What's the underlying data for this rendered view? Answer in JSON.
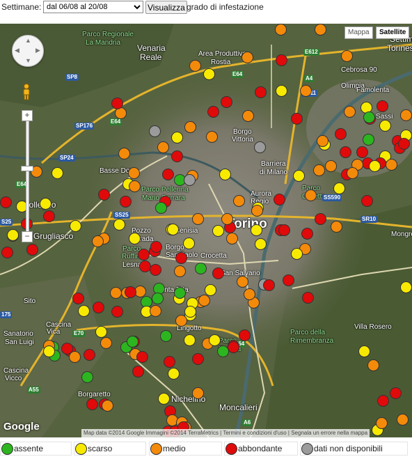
{
  "toolbar": {
    "weeks_label": "Settimane:",
    "weeks_selected": "dal 06/08 al 20/08",
    "show_button": "Visualizza",
    "legend_title": "grado di infestazione"
  },
  "map": {
    "type_buttons": [
      "Mappa",
      "Satellite"
    ],
    "active_type": "Satellite",
    "attribution": "Map data ©2014 Google Immagini ©2014 TerraMetrics | Termini e condizioni d'uso | Segnala un errore nella mappa",
    "google_logo": "Google",
    "zoom_in_label": "+",
    "zoom_out_label": "−",
    "icons": [
      "pan-control-icon",
      "pegman-icon",
      "zoom-in-icon",
      "zoom-out-icon"
    ],
    "place_labels": [
      {
        "text": "Venaria",
        "cls": "med"
      },
      {
        "text": "Reale",
        "cls": "med"
      },
      {
        "text": "Parco Regionale",
        "cls": "green"
      },
      {
        "text": "La Mandria",
        "cls": "green"
      },
      {
        "text": "Area Produttiva",
        "cls": ""
      },
      {
        "text": "Rostia",
        "cls": ""
      },
      {
        "text": "Settimo",
        "cls": "med"
      },
      {
        "text": "Torinese",
        "cls": "med"
      },
      {
        "text": "Cebrosa 90",
        "cls": ""
      },
      {
        "text": "Olimpia",
        "cls": ""
      },
      {
        "text": "Famolenta",
        "cls": ""
      },
      {
        "text": "Sassi",
        "cls": ""
      },
      {
        "text": "Borgo",
        "cls": ""
      },
      {
        "text": "Vittoria",
        "cls": ""
      },
      {
        "text": "Barriera",
        "cls": ""
      },
      {
        "text": "di Milano",
        "cls": ""
      },
      {
        "text": "Basse Dora",
        "cls": ""
      },
      {
        "text": "Parco Pellerina",
        "cls": "green"
      },
      {
        "text": "Mario Carrara",
        "cls": "green"
      },
      {
        "text": "Aurora",
        "cls": ""
      },
      {
        "text": "Regio",
        "cls": ""
      },
      {
        "text": "Parco",
        "cls": "green"
      },
      {
        "text": "Colletta",
        "cls": "green"
      },
      {
        "text": "Collegno",
        "cls": "med"
      },
      {
        "text": "Grugliasco",
        "cls": "med"
      },
      {
        "text": "Pozzo",
        "cls": ""
      },
      {
        "text": "Strada",
        "cls": ""
      },
      {
        "text": "Cenisia",
        "cls": ""
      },
      {
        "text": "Torino",
        "cls": "big"
      },
      {
        "text": "Mongreno",
        "cls": ""
      },
      {
        "text": "Parco",
        "cls": "green"
      },
      {
        "text": "Ruffini",
        "cls": "green"
      },
      {
        "text": "Borgo",
        "cls": ""
      },
      {
        "text": "San Paolo",
        "cls": ""
      },
      {
        "text": "Crocetta",
        "cls": ""
      },
      {
        "text": "Lesna",
        "cls": ""
      },
      {
        "text": "San Salvario",
        "cls": ""
      },
      {
        "text": "Santa Rita",
        "cls": ""
      },
      {
        "text": "Sito",
        "cls": ""
      },
      {
        "text": "Lingotto",
        "cls": ""
      },
      {
        "text": "Villa Rosero",
        "cls": ""
      },
      {
        "text": "Cascina",
        "cls": ""
      },
      {
        "text": "Vica",
        "cls": ""
      },
      {
        "text": "Parco",
        "cls": "green"
      },
      {
        "text": "Europa",
        "cls": "green"
      },
      {
        "text": "Parco della",
        "cls": "green"
      },
      {
        "text": "Rimembranza",
        "cls": "green"
      },
      {
        "text": "Sanatorio",
        "cls": ""
      },
      {
        "text": "San Luigi",
        "cls": ""
      },
      {
        "text": "Cascina",
        "cls": ""
      },
      {
        "text": "Vicco",
        "cls": ""
      },
      {
        "text": "Borgaretto",
        "cls": ""
      },
      {
        "text": "Nichelino",
        "cls": "med"
      },
      {
        "text": "Moncalieri",
        "cls": "med"
      }
    ],
    "road_shields": [
      {
        "text": "SP8",
        "cls": ""
      },
      {
        "text": "E64",
        "cls": "green"
      },
      {
        "text": "SP176",
        "cls": ""
      },
      {
        "text": "SP24",
        "cls": ""
      },
      {
        "text": "E64",
        "cls": "green"
      },
      {
        "text": "E612",
        "cls": "green"
      },
      {
        "text": "A4",
        "cls": "green"
      },
      {
        "text": "E64",
        "cls": "green"
      },
      {
        "text": "SS11",
        "cls": ""
      },
      {
        "text": "S25",
        "cls": ""
      },
      {
        "text": "SS25",
        "cls": ""
      },
      {
        "text": "SS590",
        "cls": ""
      },
      {
        "text": "SR10",
        "cls": ""
      },
      {
        "text": "E70",
        "cls": "green"
      },
      {
        "text": "A55",
        "cls": "green"
      },
      {
        "text": "A6",
        "cls": "green"
      },
      {
        "text": "E64",
        "cls": "green"
      },
      {
        "text": "175",
        "cls": ""
      }
    ]
  },
  "legend": {
    "items": [
      {
        "label": "assente",
        "color": "#2db51f"
      },
      {
        "label": "scarso",
        "color": "#f7ea00"
      },
      {
        "label": "medio",
        "color": "#f48a0a"
      },
      {
        "label": "abbondante",
        "color": "#e00a0a"
      },
      {
        "label": "dati non disponibili",
        "color": "#9b9b9b"
      }
    ]
  },
  "markers": [
    {
      "level": "medio"
    },
    {
      "level": "medio"
    },
    {
      "level": "medio"
    },
    {
      "level": "abbondante"
    },
    {
      "level": "medio"
    },
    {
      "level": "scarso"
    },
    {
      "level": "medio"
    },
    {
      "level": "abbondante"
    },
    {
      "level": "medio"
    },
    {
      "level": "scarso"
    },
    {
      "level": "abbondante"
    },
    {
      "level": "scarso"
    },
    {
      "level": "medio"
    },
    {
      "level": "abbondante"
    },
    {
      "level": "medio"
    },
    {
      "level": "abbondante"
    },
    {
      "level": "abbondante"
    },
    {
      "level": "abbondante"
    },
    {
      "level": "medio"
    },
    {
      "level": "medio"
    },
    {
      "level": "abbondante"
    },
    {
      "level": "abbondante"
    },
    {
      "level": "scarso"
    },
    {
      "level": "assente"
    },
    {
      "level": "scarso"
    },
    {
      "level": "abbondante"
    },
    {
      "level": "abbondante"
    },
    {
      "level": "scarso"
    },
    {
      "level": "abbondante"
    },
    {
      "level": "medio"
    },
    {
      "level": "abbondante"
    },
    {
      "level": "scarso"
    },
    {
      "level": "abbondante"
    },
    {
      "level": "dati non disponibili"
    },
    {
      "level": "medio"
    },
    {
      "level": "medio"
    },
    {
      "level": "medio"
    },
    {
      "level": "dati non disponibili"
    },
    {
      "level": "scarso"
    },
    {
      "level": "medio"
    },
    {
      "level": "abbondante"
    },
    {
      "level": "abbondante"
    },
    {
      "level": "abbondante"
    },
    {
      "level": "medio"
    },
    {
      "level": "scarso"
    },
    {
      "level": "medio"
    },
    {
      "level": "scarso"
    },
    {
      "level": "abbondante"
    },
    {
      "level": "assente"
    },
    {
      "level": "scarso"
    },
    {
      "level": "medio"
    },
    {
      "level": "medio"
    },
    {
      "level": "abbondante"
    },
    {
      "level": "medio"
    },
    {
      "level": "abbondante"
    },
    {
      "level": "medio"
    },
    {
      "level": "scarso"
    },
    {
      "level": "abbondante"
    },
    {
      "level": "medio"
    },
    {
      "level": "scarso"
    },
    {
      "level": "assente"
    },
    {
      "level": "abbondante"
    },
    {
      "level": "dati non disponibili"
    },
    {
      "level": "scarso"
    },
    {
      "level": "scarso"
    },
    {
      "level": "medio"
    },
    {
      "level": "abbondante"
    },
    {
      "level": "scarso"
    },
    {
      "level": "medio"
    },
    {
      "level": "abbondante"
    },
    {
      "level": "abbondante"
    },
    {
      "level": "medio"
    },
    {
      "level": "abbondante"
    },
    {
      "level": "medio"
    },
    {
      "level": "scarso"
    },
    {
      "level": "medio"
    },
    {
      "level": "abbondante"
    },
    {
      "level": "scarso"
    },
    {
      "level": "abbondante"
    },
    {
      "level": "scarso"
    },
    {
      "level": "abbondante"
    },
    {
      "level": "scarso"
    },
    {
      "level": "medio"
    },
    {
      "level": "abbondante"
    },
    {
      "level": "medio"
    },
    {
      "level": "scarso"
    },
    {
      "level": "abbondante"
    },
    {
      "level": "scarso"
    },
    {
      "level": "assente"
    },
    {
      "level": "scarso"
    },
    {
      "level": "abbondante"
    },
    {
      "level": "abbondante"
    },
    {
      "level": "medio"
    },
    {
      "level": "medio"
    },
    {
      "level": "scarso"
    },
    {
      "level": "scarso"
    },
    {
      "level": "medio"
    },
    {
      "level": "abbondante"
    },
    {
      "level": "medio"
    },
    {
      "level": "abbondante"
    },
    {
      "level": "scarso"
    },
    {
      "level": "scarso"
    },
    {
      "level": "scarso"
    },
    {
      "level": "abbondante"
    },
    {
      "level": "abbondante"
    },
    {
      "level": "abbondante"
    },
    {
      "level": "medio"
    },
    {
      "level": "scarso"
    },
    {
      "level": "abbondante"
    },
    {
      "level": "scarso"
    },
    {
      "level": "scarso"
    },
    {
      "level": "dati non disponibili"
    },
    {
      "level": "abbondante"
    },
    {
      "level": "assente"
    },
    {
      "level": "abbondante"
    },
    {
      "level": "medio"
    },
    {
      "level": "medio"
    },
    {
      "level": "medio"
    },
    {
      "level": "assente"
    },
    {
      "level": "abbondante"
    },
    {
      "level": "scarso"
    },
    {
      "level": "medio"
    },
    {
      "level": "medio"
    },
    {
      "level": "abbondante"
    },
    {
      "level": "medio"
    },
    {
      "level": "medio"
    },
    {
      "level": "scarso"
    },
    {
      "level": "abbondante"
    },
    {
      "level": "assente"
    },
    {
      "level": "scarso"
    },
    {
      "level": "medio"
    },
    {
      "level": "medio"
    },
    {
      "level": "abbondante"
    },
    {
      "level": "abbondante"
    },
    {
      "level": "assente"
    },
    {
      "level": "scarso"
    },
    {
      "level": "abbondante"
    },
    {
      "level": "scarso"
    },
    {
      "level": "medio"
    },
    {
      "level": "abbondante"
    },
    {
      "level": "medio"
    },
    {
      "level": "abbondante"
    },
    {
      "level": "abbondante"
    },
    {
      "level": "assente"
    },
    {
      "level": "scarso"
    },
    {
      "level": "abbondante"
    },
    {
      "level": "assente"
    },
    {
      "level": "medio"
    },
    {
      "level": "assente"
    },
    {
      "level": "assente"
    },
    {
      "level": "abbondante"
    },
    {
      "level": "scarso"
    },
    {
      "level": "assente"
    },
    {
      "level": "abbondante"
    },
    {
      "level": "abbondante"
    },
    {
      "level": "scarso"
    },
    {
      "level": "scarso"
    },
    {
      "level": "abbondante"
    },
    {
      "level": "medio"
    },
    {
      "level": "medio"
    },
    {
      "level": "assente"
    },
    {
      "level": "assente"
    },
    {
      "level": "medio"
    },
    {
      "level": "abbondante"
    },
    {
      "level": "scarso"
    },
    {
      "level": "medio"
    },
    {
      "level": "abbondante"
    },
    {
      "level": "abbondante"
    },
    {
      "level": "scarso"
    },
    {
      "level": "assente"
    },
    {
      "level": "abbondante"
    },
    {
      "level": "abbondante"
    },
    {
      "level": "abbondante"
    },
    {
      "level": "scarso"
    },
    {
      "level": "medio"
    },
    {
      "level": "scarso"
    },
    {
      "level": "abbondante"
    },
    {
      "level": "medio"
    },
    {
      "level": "scarso"
    },
    {
      "level": "abbondante"
    },
    {
      "level": "medio"
    },
    {
      "level": "abbondante"
    },
    {
      "level": "abbondante"
    },
    {
      "level": "medio"
    },
    {
      "level": "medio"
    },
    {
      "level": "abbondante"
    },
    {
      "level": "medio"
    },
    {
      "level": "medio"
    },
    {
      "level": "medio"
    },
    {
      "level": "abbondante"
    },
    {
      "level": "scarso"
    },
    {
      "level": "medio"
    },
    {
      "level": "abbondante"
    },
    {
      "level": "abbondante"
    },
    {
      "level": "abbondante"
    }
  ]
}
